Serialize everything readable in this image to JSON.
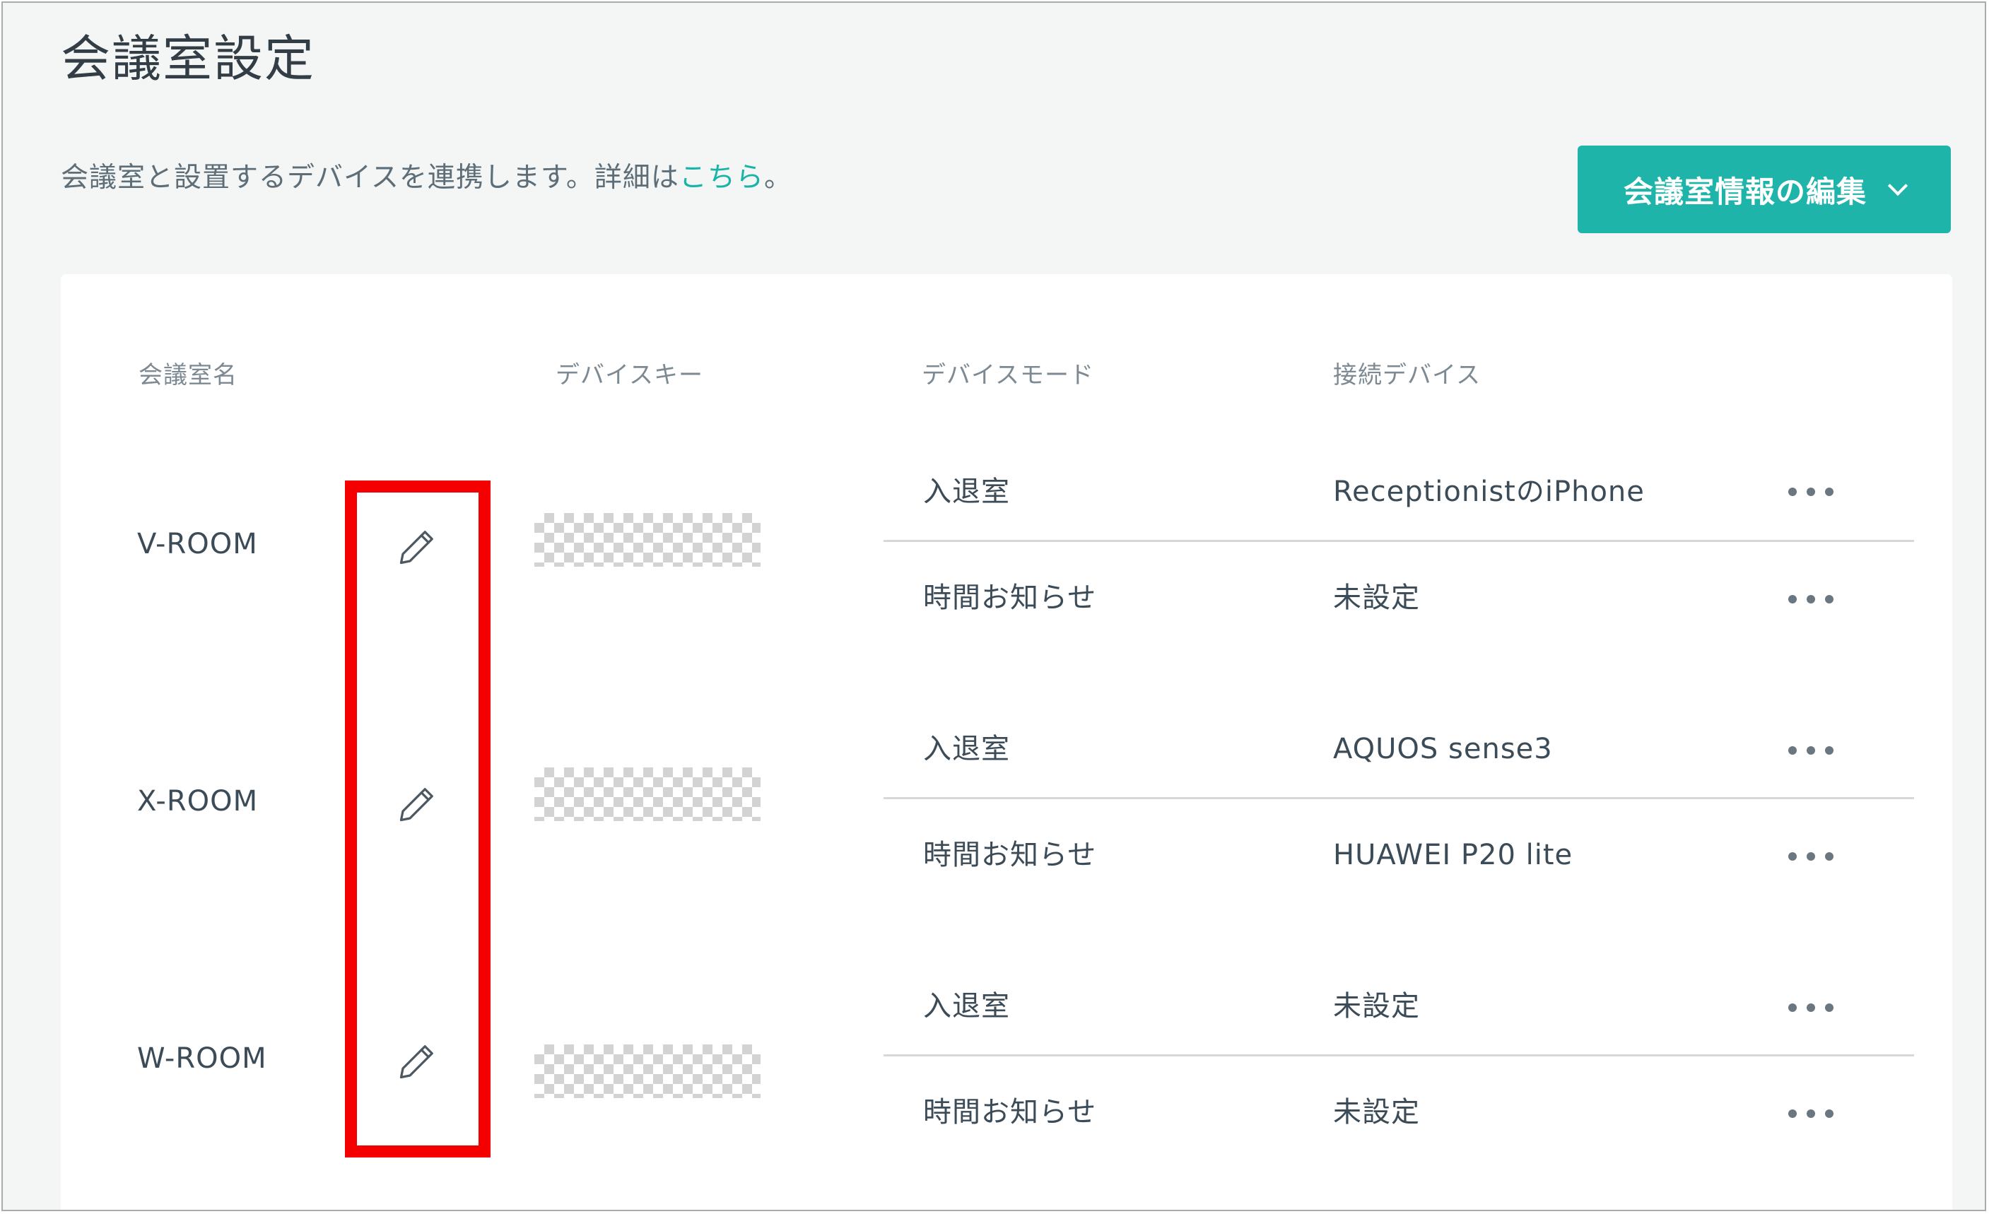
{
  "page": {
    "title": "会議室設定",
    "description_text": "会議室と設置するデバイスを連携します。詳細は",
    "description_link": "こちら",
    "description_end": "。"
  },
  "edit_button": {
    "label": "会議室情報の編集",
    "icon": "chevron-down-icon"
  },
  "table": {
    "headers": {
      "room_name": "会議室名",
      "device_key": "デバイスキー",
      "device_mode": "デバイスモード",
      "connected_device": "接続デバイス"
    },
    "rooms": [
      {
        "name": "V-ROOM",
        "modes": [
          {
            "mode": "入退室",
            "device": "ReceptionistのiPhone"
          },
          {
            "mode": "時間お知らせ",
            "device": "未設定"
          }
        ]
      },
      {
        "name": "X-ROOM",
        "modes": [
          {
            "mode": "入退室",
            "device": "AQUOS sense3"
          },
          {
            "mode": "時間お知らせ",
            "device": "HUAWEI P20 lite"
          }
        ]
      },
      {
        "name": "W-ROOM",
        "modes": [
          {
            "mode": "入退室",
            "device": "未設定"
          },
          {
            "mode": "時間お知らせ",
            "device": "未設定"
          }
        ]
      }
    ]
  },
  "colors": {
    "accent": "#1fb4aa",
    "highlight": "#f50000",
    "background": "#f4f6f6"
  }
}
